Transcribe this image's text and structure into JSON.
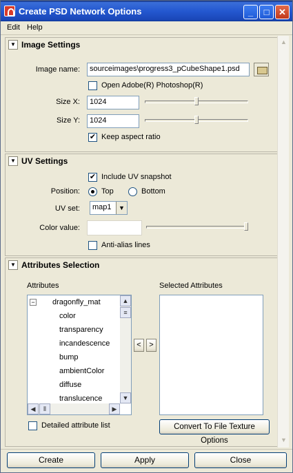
{
  "window": {
    "title": "Create PSD Network Options"
  },
  "menu": {
    "items": [
      "Edit",
      "Help"
    ]
  },
  "image_settings": {
    "title": "Image Settings",
    "image_name_label": "Image name:",
    "image_name_value": "sourceimages\\progress3_pCubeShape1.psd",
    "open_photoshop_label": "Open Adobe(R) Photoshop(R)",
    "open_photoshop_checked": false,
    "size_x_label": "Size X:",
    "size_x_value": "1024",
    "size_y_label": "Size Y:",
    "size_y_value": "1024",
    "keep_aspect_label": "Keep aspect ratio",
    "keep_aspect_checked": true
  },
  "uv_settings": {
    "title": "UV Settings",
    "include_uv_label": "Include UV snapshot",
    "include_uv_checked": true,
    "position_label": "Position:",
    "position_options": [
      "Top",
      "Bottom"
    ],
    "position_selected": "Top",
    "uv_set_label": "UV set:",
    "uv_set_value": "map1",
    "color_value_label": "Color value:",
    "color_value_color": "#ffffff",
    "anti_alias_label": "Anti-alias lines",
    "anti_alias_checked": false
  },
  "attributes_selection": {
    "title": "Attributes Selection",
    "attributes_header": "Attributes",
    "selected_header": "Selected Attributes",
    "tree_root": "dragonfly_mat",
    "tree_items": [
      "color",
      "transparency",
      "incandescence",
      "bump",
      "ambientColor",
      "diffuse",
      "translucence"
    ],
    "selected_items": [],
    "move_left_label": "<",
    "move_right_label": ">",
    "detailed_label": "Detailed attribute list",
    "detailed_checked": false,
    "convert_button": "Convert To File Texture Options"
  },
  "buttons": {
    "create": "Create",
    "apply": "Apply",
    "close": "Close"
  }
}
